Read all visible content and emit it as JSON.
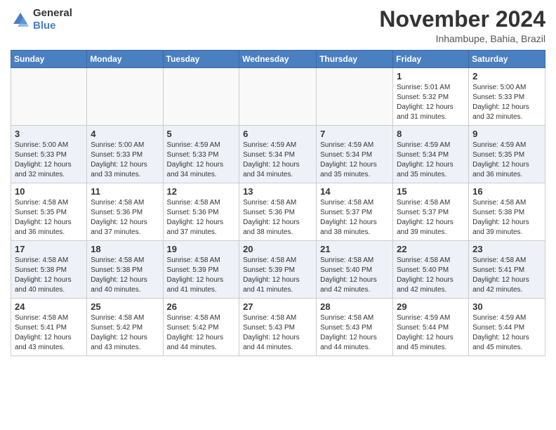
{
  "logo": {
    "general": "General",
    "blue": "Blue"
  },
  "header": {
    "month": "November 2024",
    "location": "Inhambupe, Bahia, Brazil"
  },
  "weekdays": [
    "Sunday",
    "Monday",
    "Tuesday",
    "Wednesday",
    "Thursday",
    "Friday",
    "Saturday"
  ],
  "rows": [
    [
      {
        "day": "",
        "info": ""
      },
      {
        "day": "",
        "info": ""
      },
      {
        "day": "",
        "info": ""
      },
      {
        "day": "",
        "info": ""
      },
      {
        "day": "",
        "info": ""
      },
      {
        "day": "1",
        "info": "Sunrise: 5:01 AM\nSunset: 5:32 PM\nDaylight: 12 hours and 31 minutes."
      },
      {
        "day": "2",
        "info": "Sunrise: 5:00 AM\nSunset: 5:33 PM\nDaylight: 12 hours and 32 minutes."
      }
    ],
    [
      {
        "day": "3",
        "info": "Sunrise: 5:00 AM\nSunset: 5:33 PM\nDaylight: 12 hours and 32 minutes."
      },
      {
        "day": "4",
        "info": "Sunrise: 5:00 AM\nSunset: 5:33 PM\nDaylight: 12 hours and 33 minutes."
      },
      {
        "day": "5",
        "info": "Sunrise: 4:59 AM\nSunset: 5:33 PM\nDaylight: 12 hours and 34 minutes."
      },
      {
        "day": "6",
        "info": "Sunrise: 4:59 AM\nSunset: 5:34 PM\nDaylight: 12 hours and 34 minutes."
      },
      {
        "day": "7",
        "info": "Sunrise: 4:59 AM\nSunset: 5:34 PM\nDaylight: 12 hours and 35 minutes."
      },
      {
        "day": "8",
        "info": "Sunrise: 4:59 AM\nSunset: 5:34 PM\nDaylight: 12 hours and 35 minutes."
      },
      {
        "day": "9",
        "info": "Sunrise: 4:59 AM\nSunset: 5:35 PM\nDaylight: 12 hours and 36 minutes."
      }
    ],
    [
      {
        "day": "10",
        "info": "Sunrise: 4:58 AM\nSunset: 5:35 PM\nDaylight: 12 hours and 36 minutes."
      },
      {
        "day": "11",
        "info": "Sunrise: 4:58 AM\nSunset: 5:36 PM\nDaylight: 12 hours and 37 minutes."
      },
      {
        "day": "12",
        "info": "Sunrise: 4:58 AM\nSunset: 5:36 PM\nDaylight: 12 hours and 37 minutes."
      },
      {
        "day": "13",
        "info": "Sunrise: 4:58 AM\nSunset: 5:36 PM\nDaylight: 12 hours and 38 minutes."
      },
      {
        "day": "14",
        "info": "Sunrise: 4:58 AM\nSunset: 5:37 PM\nDaylight: 12 hours and 38 minutes."
      },
      {
        "day": "15",
        "info": "Sunrise: 4:58 AM\nSunset: 5:37 PM\nDaylight: 12 hours and 39 minutes."
      },
      {
        "day": "16",
        "info": "Sunrise: 4:58 AM\nSunset: 5:38 PM\nDaylight: 12 hours and 39 minutes."
      }
    ],
    [
      {
        "day": "17",
        "info": "Sunrise: 4:58 AM\nSunset: 5:38 PM\nDaylight: 12 hours and 40 minutes."
      },
      {
        "day": "18",
        "info": "Sunrise: 4:58 AM\nSunset: 5:38 PM\nDaylight: 12 hours and 40 minutes."
      },
      {
        "day": "19",
        "info": "Sunrise: 4:58 AM\nSunset: 5:39 PM\nDaylight: 12 hours and 41 minutes."
      },
      {
        "day": "20",
        "info": "Sunrise: 4:58 AM\nSunset: 5:39 PM\nDaylight: 12 hours and 41 minutes."
      },
      {
        "day": "21",
        "info": "Sunrise: 4:58 AM\nSunset: 5:40 PM\nDaylight: 12 hours and 42 minutes."
      },
      {
        "day": "22",
        "info": "Sunrise: 4:58 AM\nSunset: 5:40 PM\nDaylight: 12 hours and 42 minutes."
      },
      {
        "day": "23",
        "info": "Sunrise: 4:58 AM\nSunset: 5:41 PM\nDaylight: 12 hours and 42 minutes."
      }
    ],
    [
      {
        "day": "24",
        "info": "Sunrise: 4:58 AM\nSunset: 5:41 PM\nDaylight: 12 hours and 43 minutes."
      },
      {
        "day": "25",
        "info": "Sunrise: 4:58 AM\nSunset: 5:42 PM\nDaylight: 12 hours and 43 minutes."
      },
      {
        "day": "26",
        "info": "Sunrise: 4:58 AM\nSunset: 5:42 PM\nDaylight: 12 hours and 44 minutes."
      },
      {
        "day": "27",
        "info": "Sunrise: 4:58 AM\nSunset: 5:43 PM\nDaylight: 12 hours and 44 minutes."
      },
      {
        "day": "28",
        "info": "Sunrise: 4:58 AM\nSunset: 5:43 PM\nDaylight: 12 hours and 44 minutes."
      },
      {
        "day": "29",
        "info": "Sunrise: 4:59 AM\nSunset: 5:44 PM\nDaylight: 12 hours and 45 minutes."
      },
      {
        "day": "30",
        "info": "Sunrise: 4:59 AM\nSunset: 5:44 PM\nDaylight: 12 hours and 45 minutes."
      }
    ]
  ]
}
